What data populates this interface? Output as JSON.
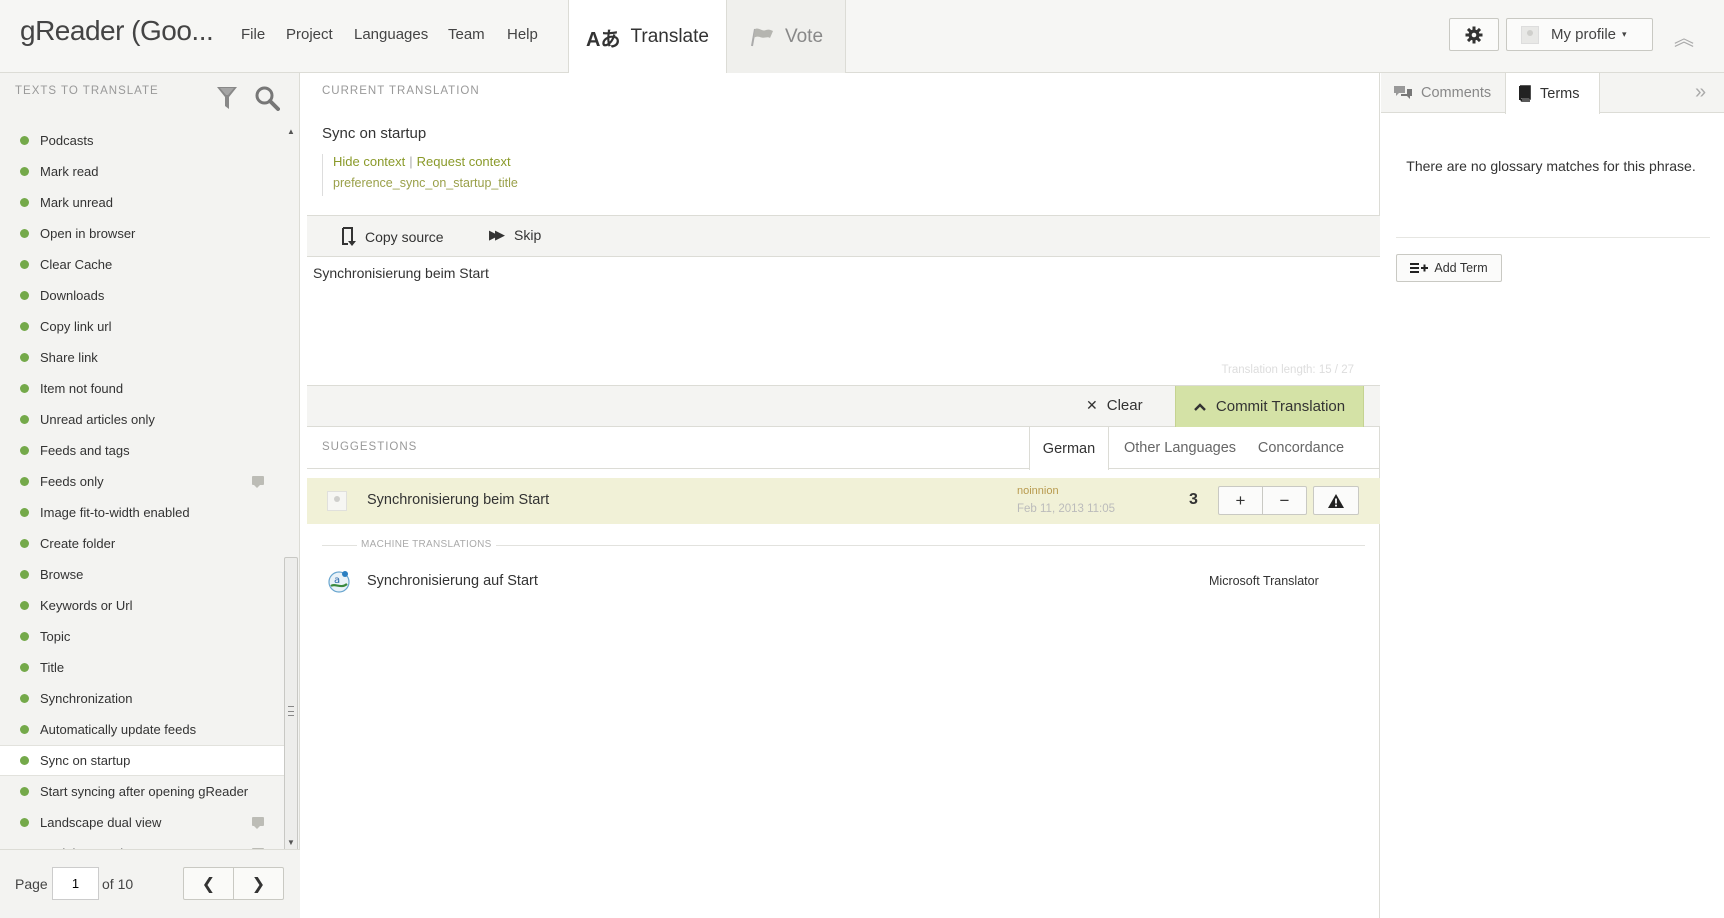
{
  "app": {
    "title": "gReader (Goo..."
  },
  "menu": {
    "items": [
      "File",
      "Project",
      "Languages",
      "Team",
      "Help"
    ]
  },
  "modes": {
    "translate": "Translate",
    "vote": "Vote"
  },
  "profile": {
    "label": "My profile"
  },
  "sidebar": {
    "title": "TEXTS TO TRANSLATE",
    "items": [
      {
        "label": "Podcasts",
        "comment": false
      },
      {
        "label": "Mark read",
        "comment": false
      },
      {
        "label": "Mark unread",
        "comment": false
      },
      {
        "label": "Open in browser",
        "comment": false
      },
      {
        "label": "Clear Cache",
        "comment": false
      },
      {
        "label": "Downloads",
        "comment": false
      },
      {
        "label": "Copy link url",
        "comment": false
      },
      {
        "label": "Share link",
        "comment": false
      },
      {
        "label": "Item not found",
        "comment": false
      },
      {
        "label": "Unread articles only",
        "comment": false
      },
      {
        "label": "Feeds and tags",
        "comment": false
      },
      {
        "label": "Feeds only",
        "comment": true
      },
      {
        "label": "Image fit-to-width enabled",
        "comment": false
      },
      {
        "label": "Create folder",
        "comment": false
      },
      {
        "label": "Browse",
        "comment": false
      },
      {
        "label": "Keywords or Url",
        "comment": false
      },
      {
        "label": "Topic",
        "comment": false
      },
      {
        "label": "Title",
        "comment": false
      },
      {
        "label": "Synchronization",
        "comment": false
      },
      {
        "label": "Automatically update feeds",
        "comment": false
      },
      {
        "label": "Sync on startup",
        "comment": false,
        "active": true
      },
      {
        "label": "Start syncing after opening gReader",
        "comment": false
      },
      {
        "label": "Landscape dual view",
        "comment": true
      },
      {
        "label": "Social Network",
        "comment": true
      }
    ],
    "status_color": "#74a94a"
  },
  "pager": {
    "label": "Page",
    "current": "1",
    "of_label": "of 10"
  },
  "current": {
    "section_label": "CURRENT TRANSLATION",
    "source_text": "Sync on startup",
    "hide_context": "Hide context",
    "separator": "|",
    "request_context": "Request context",
    "key": "preference_sync_on_startup_title"
  },
  "editor": {
    "copy_source": "Copy source",
    "skip": "Skip",
    "translation_value": "Synchronisierung beim Start",
    "length_info": "Translation length: 15 / 27",
    "clear": "Clear",
    "commit": "Commit Translation",
    "commit_color": "#d4e2a6"
  },
  "suggestions": {
    "section_label": "SUGGESTIONS",
    "tabs": {
      "german": "German",
      "other": "Other Languages",
      "concordance": "Concordance"
    },
    "items": [
      {
        "text": "Synchronisierung beim Start",
        "user": "noinnion",
        "date": "Feb 11, 2013 11:05",
        "votes": "3"
      }
    ],
    "machine_label": "MACHINE TRANSLATIONS",
    "machine": [
      {
        "text": "Synchronisierung auf Start",
        "provider": "Microsoft Translator"
      }
    ]
  },
  "right_panel": {
    "tabs": {
      "comments": "Comments",
      "terms": "Terms"
    },
    "no_matches": "There are no glossary matches for this phrase.",
    "add_term": "Add Term"
  }
}
